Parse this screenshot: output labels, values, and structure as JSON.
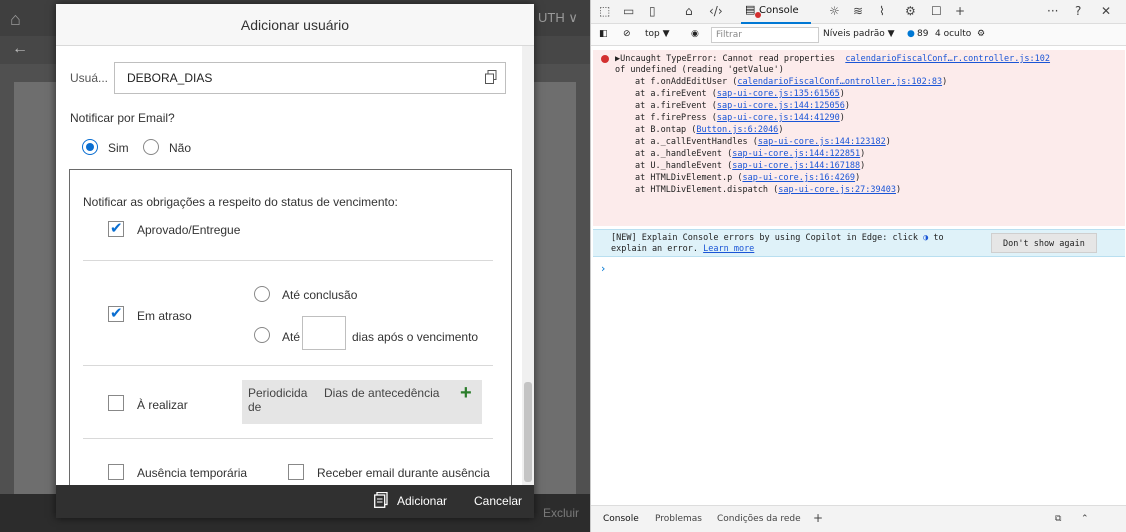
{
  "app": {
    "header_text": "UTH",
    "delete_label": "Excluir"
  },
  "dialog": {
    "title": "Adicionar usuário",
    "user_label": "Usuá...",
    "user_value": "DEBORA_DIAS",
    "notify_email_label": "Notificar por Email?",
    "radio_yes": "Sim",
    "radio_no": "Não",
    "notify_yes_selected": true,
    "panel_title": "Notificar as obrigações a respeito do status de vencimento:",
    "approved_label": "Aprovado/Entregue",
    "approved_checked": true,
    "late_label": "Em atraso",
    "late_checked": true,
    "until_conclusion_label": "Até conclusão",
    "until_label": "Até",
    "days_after_label": "dias após o vencimento",
    "to_do_label": "À realizar",
    "to_do_checked": false,
    "col_periodicity": "Periodicida de",
    "col_days_ahead": "Dias de antecedência",
    "absence_label": "Ausência temporária",
    "absence_checked": false,
    "receive_email_label": "Receber email durante ausência",
    "receive_email_checked": false,
    "add_button": "Adicionar",
    "cancel_button": "Cancelar"
  },
  "devtools": {
    "console_tab": "Console",
    "context_select": "top ▼",
    "filter_placeholder": "Filtrar",
    "levels": "Níveis padrão ▼",
    "issues_count": "89",
    "hidden_count": "4 oculto",
    "error": {
      "line1": "▶Uncaught TypeError: Cannot read properties",
      "line1_link": "calendarioFiscalConf…r.controller.js:102",
      "line2": "of undefined (reading 'getValue')",
      "stack": [
        {
          "text": "at f.onAddEditUser (",
          "link": "calendarioFiscalConf…ontroller.js:102:83",
          "end": ")"
        },
        {
          "text": "at a.fireEvent (",
          "link": "sap-ui-core.js:135:61565",
          "end": ")"
        },
        {
          "text": "at a.fireEvent (",
          "link": "sap-ui-core.js:144:125056",
          "end": ")"
        },
        {
          "text": "at f.firePress (",
          "link": "sap-ui-core.js:144:41290",
          "end": ")"
        },
        {
          "text": "at B.ontap (",
          "link": "Button.js:6:2046",
          "end": ")"
        },
        {
          "text": "at a._callEventHandles (",
          "link": "sap-ui-core.js:144:123182",
          "end": ")"
        },
        {
          "text": "at a._handleEvent (",
          "link": "sap-ui-core.js:144:122851",
          "end": ")"
        },
        {
          "text": "at U._handleEvent (",
          "link": "sap-ui-core.js:144:167188",
          "end": ")"
        },
        {
          "text": "at HTMLDivElement.p (",
          "link": "sap-ui-core.js:16:4269",
          "end": ")"
        },
        {
          "text": "at HTMLDivElement.dispatch (",
          "link": "sap-ui-core.js:27:39403",
          "end": ")"
        }
      ]
    },
    "info_line1": "[NEW] Explain Console errors by using Copilot in Edge: click",
    "info_line1_end": "to",
    "info_line2": "explain an error.",
    "info_link": "Learn more",
    "dont_show": "Don't show again",
    "bottom_tabs": [
      "Console",
      "Problemas",
      "Condições da rede"
    ]
  }
}
